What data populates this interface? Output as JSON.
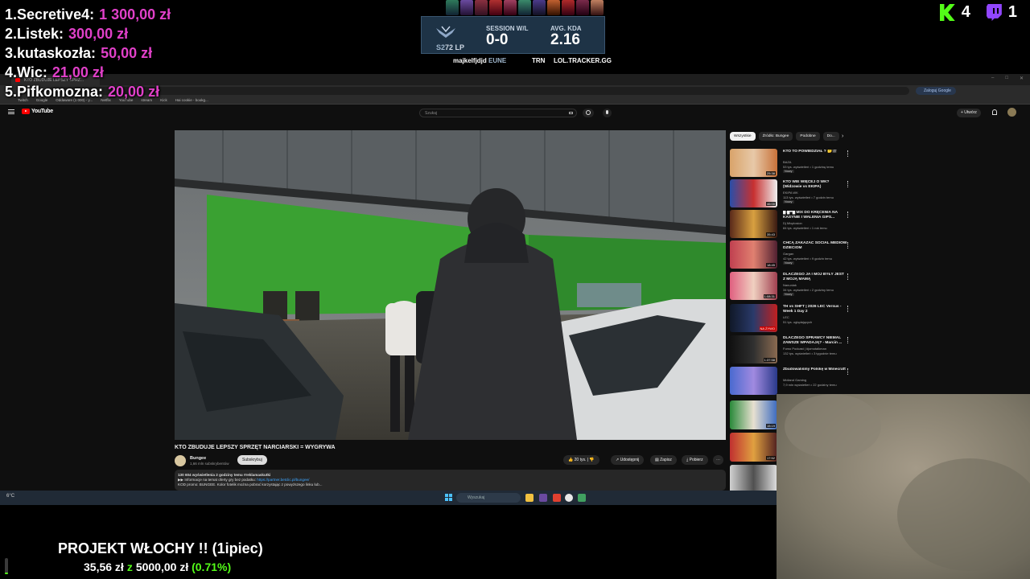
{
  "donors": [
    {
      "rank": "1.",
      "name": "Secretive4:",
      "amount": "1 300,00 zł"
    },
    {
      "rank": "2.",
      "name": "Listek:",
      "amount": "300,00 zł"
    },
    {
      "rank": "3.",
      "name": "kutaskozła:",
      "amount": "50,00 zł"
    },
    {
      "rank": "4.",
      "name": "Wic:",
      "amount": "21,00 zł"
    },
    {
      "rank": "5.",
      "name": "Pifkomozna:",
      "amount": "20,00 zł"
    }
  ],
  "lol_tracker": {
    "lp": "72 LP",
    "session_label": "SESSION W/L",
    "session_value": "0-0",
    "kda_label": "AVG. KDA",
    "kda_value": "2.16",
    "summoner": "majkelfjdjd",
    "server": "EUNE",
    "trn": "TRN",
    "tracker_url": "LOL.TRACKER.GG"
  },
  "platform_counts": {
    "kick": "4",
    "twitch": "1"
  },
  "browser": {
    "tab_title": "KTO ZBUDUJE LEPSZY SPRZ...",
    "google_button": "Zaloguj Google",
    "bookmarks": [
      "Twitch",
      "Google",
      "Oddaware (1 000) - y...",
      "Netflix",
      "YouTube",
      "stream",
      "Kick",
      "Hai cookie - bookg..."
    ],
    "window_controls": [
      "–",
      "□",
      "✕"
    ]
  },
  "youtube": {
    "logo_text": "YouTube",
    "search_placeholder": "Szukaj",
    "create_label": "+ Utwórz",
    "video_title": "KTO ZBUDUJE LEPSZY SPRZĘT NARCIARSKI = WYGRYWA",
    "channel_name": "Bungee",
    "channel_subs": "1,66 mln subskrybentów",
    "subscribe_label": "Subskrybuj",
    "likes": "20 tys.",
    "share_label": "Udostępnij",
    "save_label": "Zapisz",
    "download_label": "Pobierz",
    "desc_stats": "130 604 wyświetlenia  2 godziny temu  #reklamaskutki",
    "desc_line2_prefix": "▶▶ Informacje na temat oferty gry bez podatku: ",
    "desc_link": "https://partner.betclic.pl/bungee/",
    "desc_line3": "KOD promo: BUNGEE. Kolor fotelik można pobrać korzystając z powyższego linku lub...",
    "chips": [
      "Wszystkie",
      "Źródło: Bungee",
      "Podobne",
      "Do..."
    ],
    "recommendations": [
      {
        "title": "KTO TO POWIEDZIAŁ ? 🤔🎬",
        "channel": "BAZA",
        "meta": "53 tys. wyświetleń • 1 godzinę temu",
        "badge": "Nowy",
        "duration": "25:38"
      },
      {
        "title": "KTO WIE WIĘCEJ O WK? (Widzowie vs EKIPA)",
        "channel": "EKIPA WK",
        "meta": "113 tys. wyświetleń • 7 godzin temu",
        "badge": "Nowy",
        "duration": "46:00"
      },
      {
        "title": "█-█▀█ MIX DO KRĘCENIA NA KASYNIE I WALENIA GIPS...",
        "channel": "Dj Mixplosion",
        "meta": "84 tys. wyświetleń • 1 rok temu",
        "badge": "",
        "duration": "35:43"
      },
      {
        "title": "CHCĄ ZAKAZAĆ SOCIAL MEDIÓW DZIECIOM",
        "channel": "Gargan",
        "meta": "42 tys. wyświetleń • 9 godzin temu",
        "badge": "Nowy",
        "duration": "18:45"
      },
      {
        "title": "DLACZEGO JA I MÓJ BYŁY JEST Z MOJĄ MAMĄ",
        "channel": "Nanuniak",
        "meta": "34 tys. wyświetleń • 2 godziny temu",
        "badge": "Nowy",
        "duration": "1:08:31"
      },
      {
        "title": "TH vs SHFT | 2026 LEC Versus - Week 1 Day 2",
        "channel": "LEC",
        "meta": "51 tys. oglądających",
        "badge": "",
        "duration": "NA ŻYWO"
      },
      {
        "title": "DLACZEGO SPRAWCY NIEMAL ZAWSZE WPADAJĄ? - Marcin ...",
        "channel": "Fomo Podcast | #jomotalkman",
        "meta": "132 tys. wyświetleń • 3 tygodnie temu",
        "badge": "",
        "duration": "1:37:58"
      },
      {
        "title": "Zbudowaliśmy Polskę w Minecraft",
        "channel": "Midland Gaming",
        "meta": "7,9 mln wyświetleń • 22 godziny temu",
        "badge": "",
        "duration": ""
      }
    ],
    "extra_durations": [
      "15:19",
      "17:52",
      ""
    ]
  },
  "taskbar": {
    "weather": "6°C",
    "search_placeholder": "Wyszukaj"
  },
  "goal": {
    "title": "PROJEKT WŁOCHY !! (1ipiec)",
    "current": "35,56 zł",
    "sep": "z",
    "target": "5000,00 zł",
    "percent": "(0.71%)",
    "fraction": 0.0071
  },
  "colors": {
    "donor_amount": "#e040c8",
    "kick_green": "#53fc18",
    "twitch_purple": "#9146ff",
    "yt_red": "#ff0000"
  },
  "icons": [
    "kick-icon",
    "twitch-icon",
    "search-icon",
    "mic-icon",
    "bell-icon",
    "like-icon",
    "dislike-icon",
    "share-icon",
    "save-icon",
    "download-icon",
    "more-icon",
    "windows-start-icon"
  ]
}
